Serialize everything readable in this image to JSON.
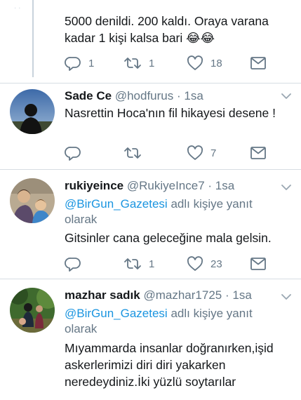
{
  "colors": {
    "link": "#1b95e0",
    "muted": "#657786",
    "text": "#14171a",
    "divider": "#d7dde3"
  },
  "tweets": [
    {
      "text_lines": [
        "5000 denildi. 200 kaldı. Oraya varana",
        "kadar 1 kişi kalsa bari 😂😂"
      ],
      "actions": {
        "reply": "1",
        "retweet": "1",
        "like": "18"
      }
    },
    {
      "name": "Sade Ce",
      "handle": "@hodfurus",
      "dot": "·",
      "time": "1sa",
      "text_lines": [
        "Nasrettin Hoca'nın fil hikayesi desene !"
      ],
      "actions": {
        "reply": "",
        "retweet": "",
        "like": "7"
      }
    },
    {
      "name": "rukiyeince",
      "handle": "@RukiyeInce7",
      "dot": "·",
      "time": "1sa",
      "reply_mention": "@BirGun_Gazetesi",
      "reply_suffix": " adlı kişiye yanıt",
      "reply_line2": "olarak",
      "text_lines": [
        "Gitsinler cana geleceğine mala gelsin."
      ],
      "actions": {
        "reply": "",
        "retweet": "1",
        "like": "23"
      }
    },
    {
      "name": "mazhar sadık",
      "handle": "@mazhar1725",
      "dot": "·",
      "time": "1sa",
      "reply_mention": "@BirGun_Gazetesi",
      "reply_suffix": " adlı kişiye yanıt",
      "reply_line2": "olarak",
      "text_lines": [
        "Mıyammarda insanlar doğranırken,işid",
        "askerlerimizi diri diri yakarken",
        "neredeydiniz.İki yüzlü soytarılar"
      ]
    }
  ]
}
